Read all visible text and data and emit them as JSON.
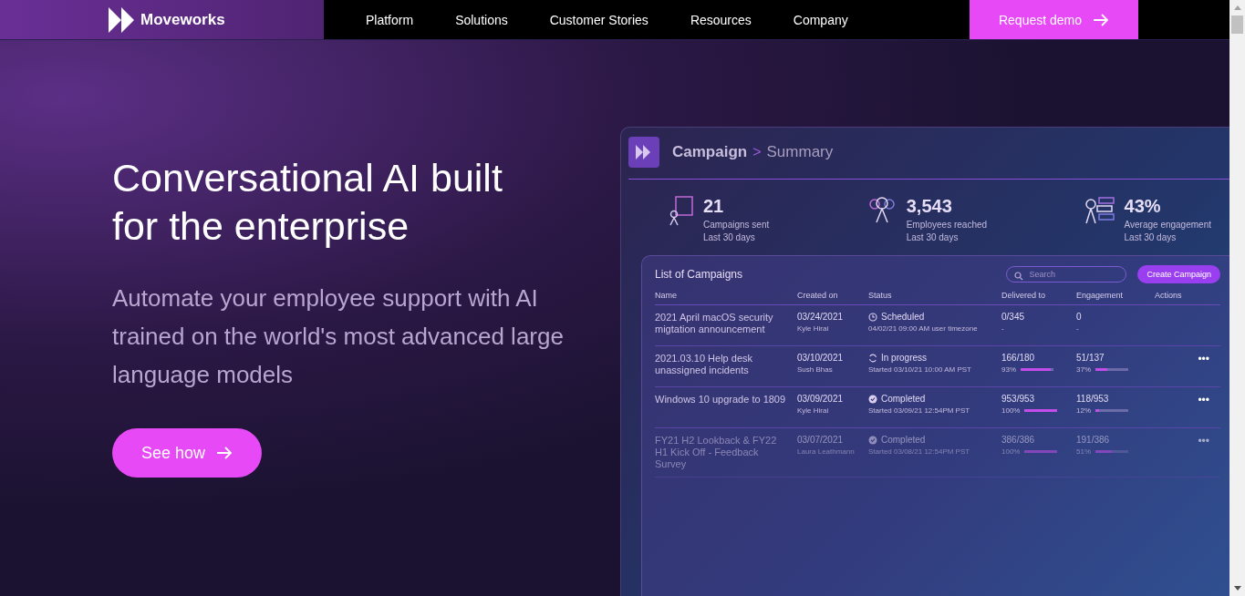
{
  "nav": {
    "brand": "Moveworks",
    "links": [
      {
        "label": "Platform"
      },
      {
        "label": "Solutions"
      },
      {
        "label": "Customer Stories"
      },
      {
        "label": "Resources"
      },
      {
        "label": "Company"
      }
    ],
    "cta": "Request demo"
  },
  "hero": {
    "title": "Conversational AI built for the enterprise",
    "subtitle": "Automate your employee support with AI trained on the world's most advanced large language models",
    "button": "See how"
  },
  "dashboard": {
    "crumb": "Campaign",
    "crumb_sep": ">",
    "page": "Summary",
    "stats": [
      {
        "kind": "campaigns",
        "value": "21",
        "label": "Campaigns sent",
        "period": "Last 30 days"
      },
      {
        "kind": "employees",
        "value": "3,543",
        "label": "Employees reached",
        "period": "Last 30 days"
      },
      {
        "kind": "engagement",
        "value": "43%",
        "label": "Average engagement",
        "period": "Last 30 days"
      }
    ],
    "list_title": "List of Campaigns",
    "search": {
      "placeholder": "Search"
    },
    "create_button": "Create Campaign",
    "columns": [
      "Name",
      "Created on",
      "Status",
      "Delivered to",
      "Engagement",
      "Actions"
    ],
    "rows": [
      {
        "name": "2021 April macOS security migtation announcement",
        "date": "03/24/2021",
        "owner": "Kyle Hirai",
        "kind": "scheduled",
        "status": "Scheduled",
        "status_detail": "04/02/21 09:00 AM user timezone",
        "delivered": "0/345",
        "delivered_pct": "-",
        "engagement": "0",
        "engagement_pct": "-",
        "actions": ""
      },
      {
        "name": "2021.03.10 Help desk unassigned incidents",
        "date": "03/10/2021",
        "owner": "Sush Bhas",
        "kind": "progress",
        "status": "In progress",
        "status_detail": "Started 03/10/21 10:00 AM PST",
        "delivered": "166/180",
        "delivered_pct": "93%",
        "delivered_bar": {
          "level": 0.93
        },
        "engagement": "51/137",
        "engagement_pct": "37%",
        "engagement_bar": {
          "level": 0.37
        },
        "actions": "•••"
      },
      {
        "name": "Windows 10 upgrade to 1809",
        "date": "03/09/2021",
        "owner": "Kyle Hirai",
        "kind": "completed",
        "status": "Completed",
        "status_detail": "Started 03/09/21 12:54PM PST",
        "delivered": "953/953",
        "delivered_pct": "100%",
        "delivered_bar": {
          "level": 1
        },
        "engagement": "118/953",
        "engagement_pct": "12%",
        "engagement_bar": {
          "level": 0.12
        },
        "actions": "•••"
      },
      {
        "name": "FY21 H2 Lookback & FY22 H1 Kick Off - Feedback Survey",
        "date": "03/07/2021",
        "owner": "Laura Leathmann",
        "kind": "completed",
        "status": "Completed",
        "status_detail": "Started 03/08/21 12:54PM PST",
        "delivered": "386/386",
        "delivered_pct": "100%",
        "delivered_bar": {
          "level": 1
        },
        "engagement": "191/386",
        "engagement_pct": "51%",
        "engagement_bar": {
          "level": 0.51
        },
        "actions": "•••"
      }
    ]
  }
}
